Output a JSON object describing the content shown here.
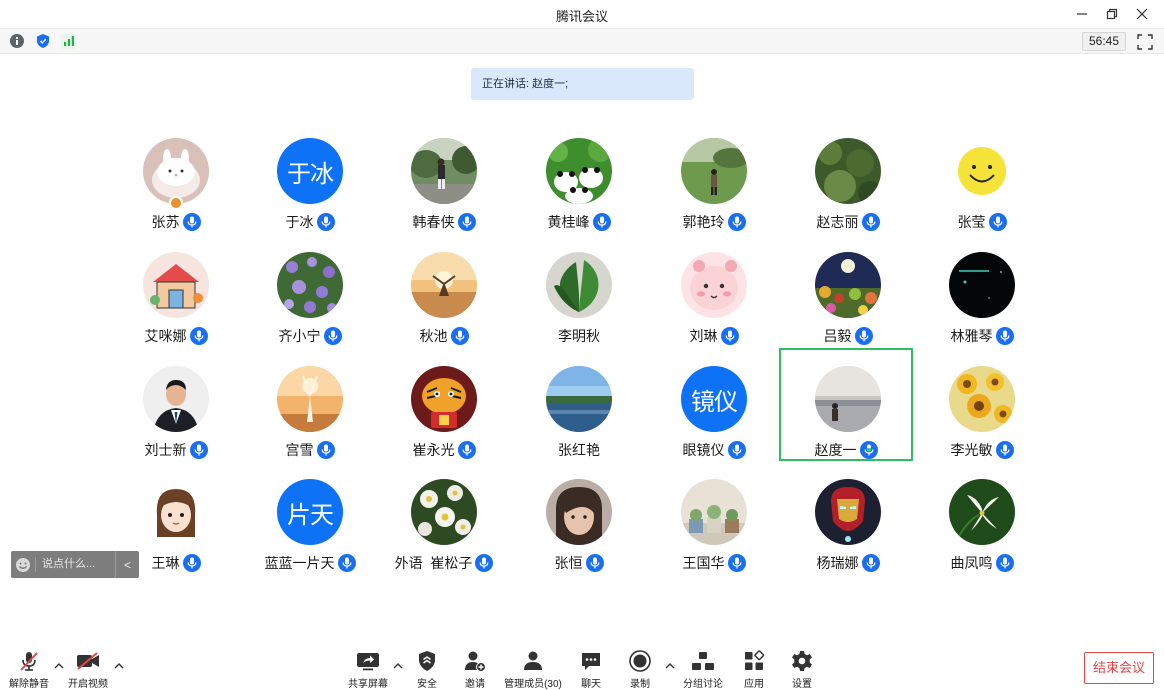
{
  "window": {
    "title": "腾讯会议"
  },
  "infobar": {
    "timer": "56:45"
  },
  "speaking": {
    "text": "正在讲话: 赵度一;"
  },
  "participants": [
    {
      "name": "张苏",
      "avatar": "bunny-cake",
      "muted": false,
      "host": true
    },
    {
      "name": "于冰",
      "avatar_text": "于冰",
      "muted": false
    },
    {
      "name": "韩春侠",
      "avatar": "person-park",
      "muted": false
    },
    {
      "name": "黄桂峰",
      "avatar": "pandas",
      "muted": false
    },
    {
      "name": "郭艳玲",
      "avatar": "person-grass",
      "muted": false
    },
    {
      "name": "赵志丽",
      "avatar": "green-moss",
      "muted": false
    },
    {
      "name": "张莹",
      "avatar": "smiley",
      "muted": false
    },
    {
      "name": "艾咪娜",
      "avatar": "cartoon-house",
      "muted": false
    },
    {
      "name": "齐小宁",
      "avatar": "purple-flowers",
      "muted": false
    },
    {
      "name": "秋池",
      "avatar": "sunset-person",
      "muted": false
    },
    {
      "name": "李明秋",
      "avatar": "green-leaves",
      "muted": true
    },
    {
      "name": "刘琳",
      "avatar": "pink-face",
      "muted": false
    },
    {
      "name": "吕毅",
      "avatar": "night-garden",
      "muted": false
    },
    {
      "name": "林雅琴",
      "avatar": "dark-space",
      "muted": false
    },
    {
      "name": "刘士新",
      "avatar": "man-suit",
      "muted": false
    },
    {
      "name": "宫雪",
      "avatar": "dancer-sunset",
      "muted": false
    },
    {
      "name": "崔永光",
      "avatar": "tiger",
      "muted": false
    },
    {
      "name": "张红艳",
      "avatar": "lake-sky",
      "muted": true
    },
    {
      "name": "眼镜仪",
      "avatar_text": "镜仪",
      "muted": false
    },
    {
      "name": "赵度一",
      "avatar": "person-lake",
      "muted": false,
      "speaking": true
    },
    {
      "name": "李光敏",
      "avatar": "sunflowers",
      "muted": false
    },
    {
      "name": "王琳",
      "avatar": "cartoon-girl",
      "muted": false
    },
    {
      "name": "蓝蓝一片天",
      "avatar_text": "片天",
      "muted": false
    },
    {
      "name": "外语  崔松子",
      "avatar": "white-flowers",
      "muted": false
    },
    {
      "name": "张恒",
      "avatar": "selfie",
      "muted": false
    },
    {
      "name": "王国华",
      "avatar": "succulents",
      "muted": false
    },
    {
      "name": "杨瑞娜",
      "avatar": "iron-man",
      "muted": false
    },
    {
      "name": "曲凤鸣",
      "avatar": "white-lily",
      "muted": false
    }
  ],
  "chat": {
    "placeholder": "说点什么...",
    "collapse": "<"
  },
  "toolbar": {
    "unmute": "解除静音",
    "start_video": "开启视频",
    "share_screen": "共享屏幕",
    "security": "安全",
    "invite": "邀请",
    "members": "管理成员(30)",
    "chat": "聊天",
    "record": "录制",
    "breakout": "分组讨论",
    "apps": "应用",
    "settings": "设置",
    "end_meeting": "结束会议"
  },
  "colors": {
    "accent": "#0d72f6",
    "mic": "#1a6ff0",
    "speaking_border": "#2fbf62",
    "end": "#e64545",
    "banner": "#d9e8fb"
  }
}
